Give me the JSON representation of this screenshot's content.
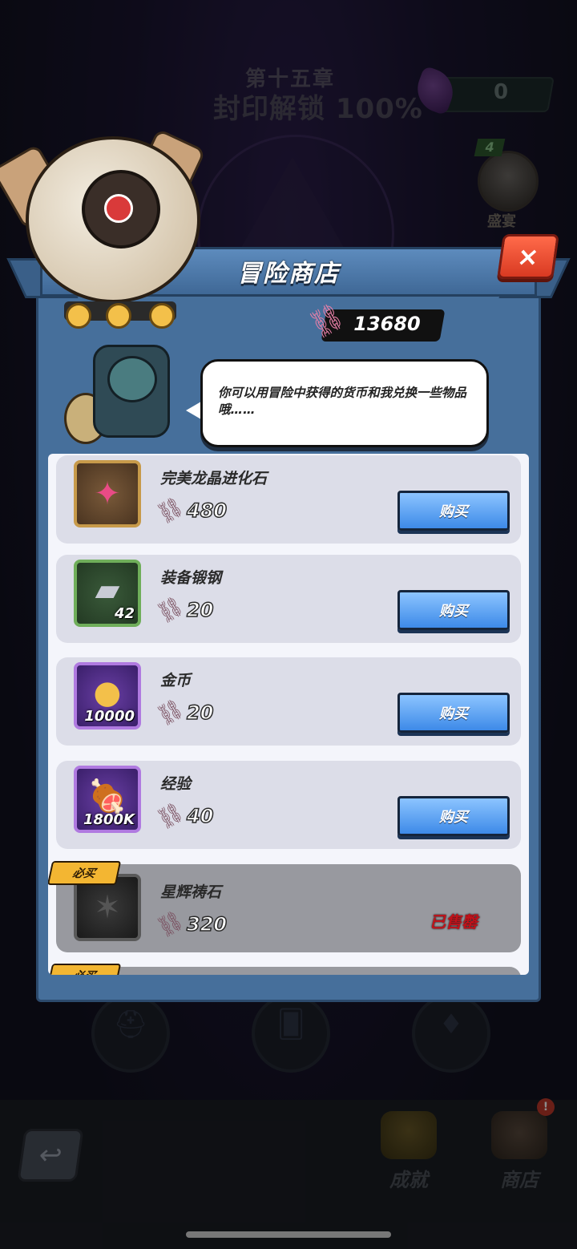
{
  "background": {
    "chapter_title": "第十五章",
    "chapter_progress": "封印解锁 100%",
    "gem_count": "0",
    "avatar_level": "4",
    "avatar_label": "盛宴"
  },
  "shop": {
    "title": "冒险商店",
    "close_label": "×",
    "currency_value": "13680",
    "npc_dialog": "你可以用冒险中获得的货币和我兑换一些物品哦……",
    "items": [
      {
        "name": "完美龙晶进化石",
        "price": "480",
        "quantity": "",
        "action": "购买",
        "icon": "crystal-icon",
        "color": "brown"
      },
      {
        "name": "装备锻钢",
        "price": "20",
        "quantity": "42",
        "action": "购买",
        "icon": "steel-ingot-icon",
        "color": "green"
      },
      {
        "name": "金币",
        "price": "20",
        "quantity": "10000",
        "action": "购买",
        "icon": "gold-coins-icon",
        "color": "purple"
      },
      {
        "name": "经验",
        "price": "40",
        "quantity": "1800K",
        "action": "购买",
        "icon": "meat-icon",
        "color": "purple"
      },
      {
        "name": "星辉祷石",
        "price": "320",
        "quantity": "",
        "status": "已售罄",
        "badge": "必买",
        "icon": "star-stone-icon",
        "color": "grey"
      }
    ],
    "next_badge": "必买"
  },
  "nav": {
    "achievements_label": "成就",
    "shop_label": "商店",
    "notification": "!"
  }
}
